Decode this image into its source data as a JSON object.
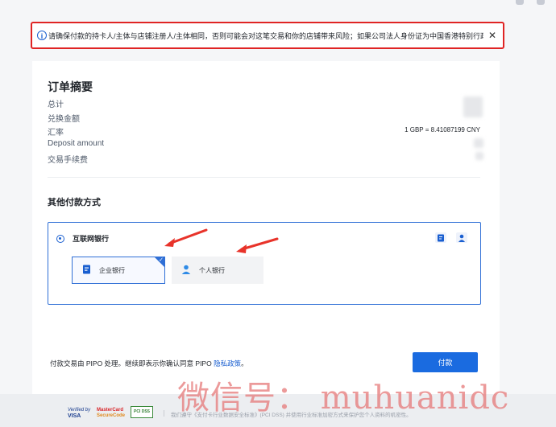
{
  "alert": {
    "text": "请确保付款的持卡人/主体与店铺注册人/主体相同，否则可能会对这笔交易和你的店铺带来风险；如果公司法人身份证为中国香港特别行政区身",
    "close": "✕"
  },
  "summary": {
    "title": "订单摘要",
    "rows": [
      "总计",
      "兑换金额",
      "汇率",
      "Deposit amount",
      "交易手续费"
    ],
    "rate_value": "1 GBP = 8.41087199 CNY"
  },
  "other": {
    "title": "其他付款方式",
    "method": "互联网银行",
    "options": [
      "企业银行",
      "个人银行"
    ]
  },
  "footer": {
    "note_prefix": "付款交易由 PIPO 处理。继续即表示你确认同意 PIPO ",
    "link": "隐私政策",
    "note_suffix": "。",
    "pay_button": "付款"
  },
  "bottom": {
    "visa_line1": "Verified by",
    "visa_line2": "VISA",
    "mc_line1": "MasterCard",
    "mc_line2": "SecureCode",
    "pci": "PCI DSS",
    "text": "我们遵守《支付卡行业数据安全标准》(PCI DSS) 并使用行业标准加密方式来保护您个人资料的机密性。"
  },
  "watermark": "微信号： muhuanidc",
  "colors": {
    "accent": "#1a6be0",
    "alert_border": "#e02424",
    "arrow": "#e8332a"
  }
}
